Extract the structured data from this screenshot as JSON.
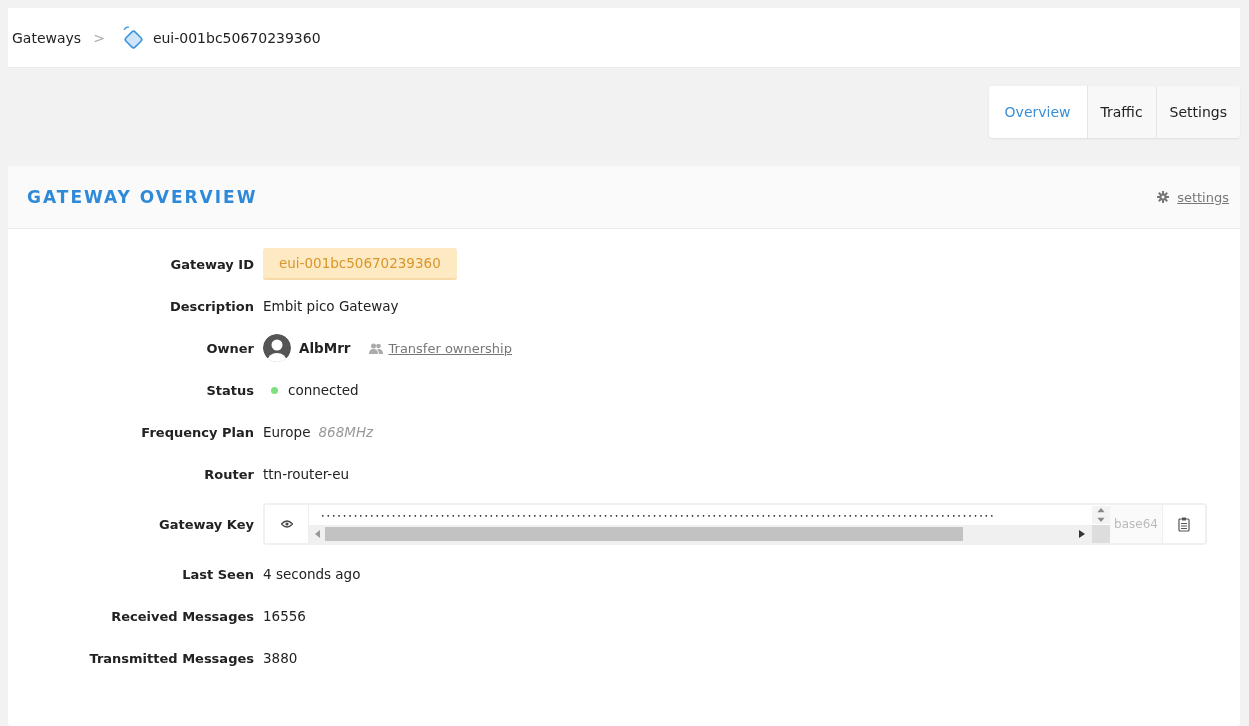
{
  "breadcrumb": {
    "parent": "Gateways",
    "separator": ">",
    "current": "eui-001bc50670239360"
  },
  "tabs": [
    {
      "label": "Overview",
      "selected": true
    },
    {
      "label": "Traffic",
      "selected": false
    },
    {
      "label": "Settings",
      "selected": false
    }
  ],
  "card": {
    "title": "GATEWAY OVERVIEW",
    "settings_link": "settings"
  },
  "fields": [
    {
      "kind": "badge",
      "label": "Gateway ID",
      "value": "eui-001bc50670239360"
    },
    {
      "kind": "text",
      "label": "Description",
      "value": "Embit pico Gateway"
    },
    {
      "kind": "owner",
      "label": "Owner",
      "value": "AlbMrr",
      "link": "Transfer ownership"
    },
    {
      "kind": "status",
      "label": "Status",
      "value": "connected",
      "color": "#7ee07e"
    },
    {
      "kind": "plan",
      "label": "Frequency Plan",
      "value": "Europe",
      "note": "868MHz"
    },
    {
      "kind": "text",
      "label": "Router",
      "value": "ttn-router-eu"
    },
    {
      "kind": "key",
      "label": "Gateway Key",
      "value": "••••••••••••••••••••••••••••••••••••••••••••••••••••••••••••••••••••••••••••••••••••••••••••••••••••••••••••••••••••••••••••",
      "format": "base64"
    },
    {
      "kind": "text",
      "label": "Last Seen",
      "value": "4 seconds ago"
    },
    {
      "kind": "text",
      "label": "Received Messages",
      "value": "16556"
    },
    {
      "kind": "text",
      "label": "Transmitted Messages",
      "value": "3880"
    }
  ]
}
